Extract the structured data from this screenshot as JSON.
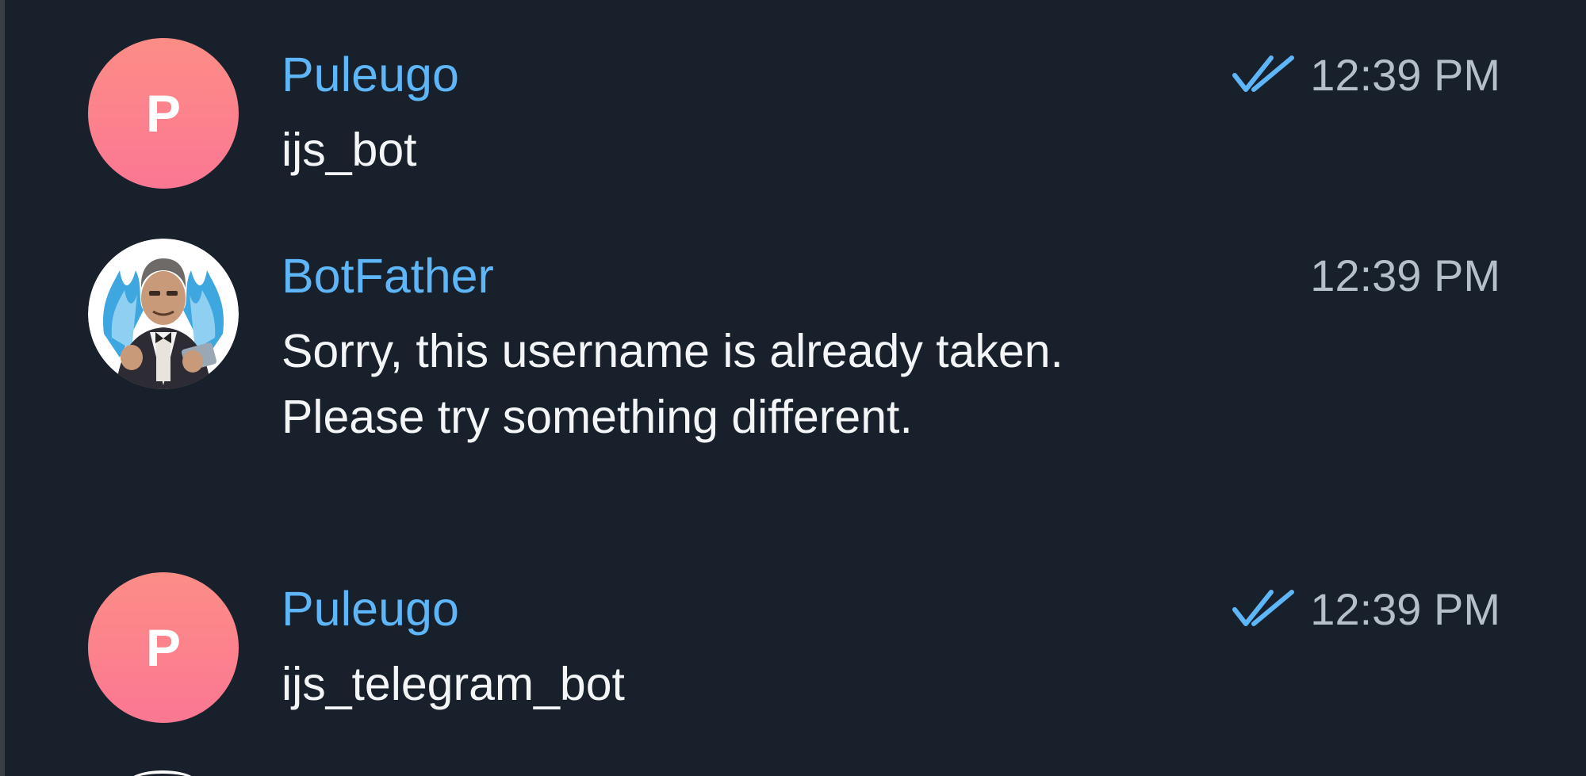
{
  "messages": [
    {
      "sender": "Puleugo",
      "avatar_letter": "P",
      "avatar_type": "letter",
      "time": "12:39 PM",
      "read_receipt": "double-check-icon",
      "text": "ijs_bot"
    },
    {
      "sender": "BotFather",
      "avatar_type": "image",
      "time": "12:39 PM",
      "text": "Sorry, this username is already taken. Please try something different."
    },
    {
      "sender": "Puleugo",
      "avatar_letter": "P",
      "avatar_type": "letter",
      "time": "12:39 PM",
      "read_receipt": "double-check-icon",
      "text": "ijs_telegram_bot"
    }
  ],
  "colors": {
    "background": "#18202b",
    "sender_name": "#5eb5f7",
    "message_text": "#f3f5f7",
    "timestamp": "#b5bfca",
    "read_check": "#5eb5f7",
    "avatar_gradient_top": "#fc8d86",
    "avatar_gradient_bottom": "#fb7793"
  }
}
